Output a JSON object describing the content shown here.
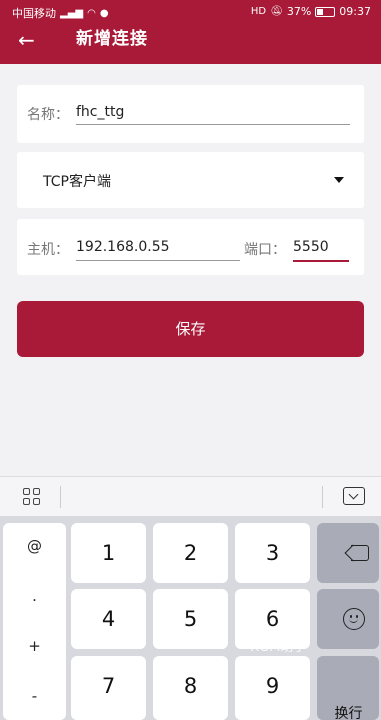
{
  "status_bar": {
    "carrier": "中国移动",
    "signal_tag": "4G",
    "hd_badge": "HD",
    "battery_percent": "37%",
    "battery_level": 0.37,
    "time": "09:37"
  },
  "app_bar": {
    "back_icon": "arrow-left-icon",
    "title": "新增连接"
  },
  "form": {
    "name_label": "名称：",
    "name_value": "fhc_ttg",
    "type_value": "TCP客户端",
    "host_label": "主机：",
    "host_value": "192.168.0.55",
    "port_label": "端口：",
    "port_value": "5550"
  },
  "save_button": "保存",
  "keyboard": {
    "toolbar_icons": [
      "grid-icon",
      "keyboard-hide-icon"
    ],
    "symbols": [
      "@",
      ".",
      "+",
      "-"
    ],
    "digits_row1": [
      "1",
      "2",
      "3"
    ],
    "digits_row2": [
      "4",
      "5",
      "6"
    ],
    "digits_row3": [
      "7",
      "8",
      "9"
    ],
    "enter_label": "换行",
    "watermark": "RGM助手"
  },
  "colors": {
    "accent": "#a81a38",
    "background": "#f2f2f4",
    "keyboard_bg": "#d8d9de",
    "key_dark": "#a9acb6"
  }
}
